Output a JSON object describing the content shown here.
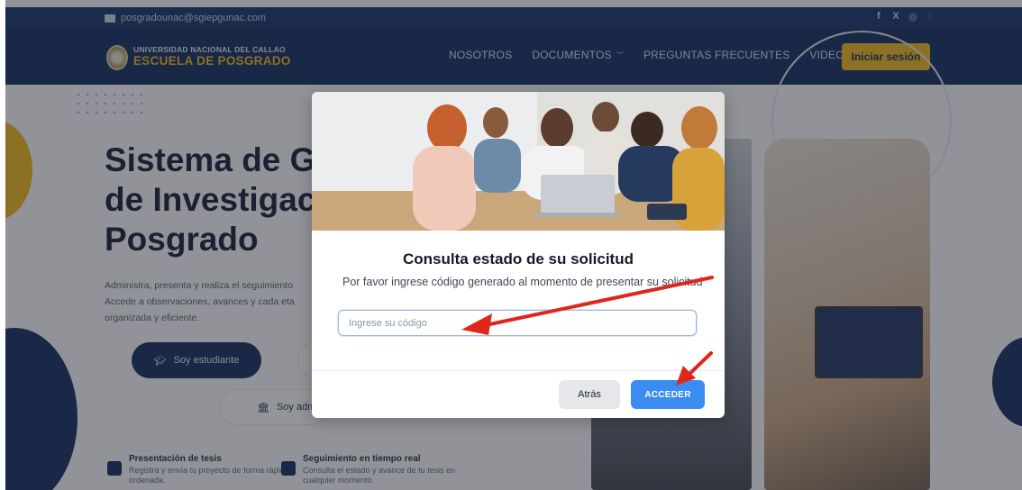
{
  "topbar": {
    "email": "posgradounac@sgiepgunac.com",
    "social_icons": [
      "facebook-icon",
      "x-icon",
      "instagram-icon",
      "whatsapp-icon"
    ]
  },
  "header": {
    "logo_top": "UNIVERSIDAD NACIONAL DEL CALLAO",
    "logo_bottom": "ESCUELA DE POSGRADO",
    "nav": [
      {
        "label": "NOSOTROS"
      },
      {
        "label": "DOCUMENTOS"
      },
      {
        "label": "PREGUNTAS FRECUENTES"
      },
      {
        "label": "VIDEOS"
      }
    ],
    "login_label": "Iniciar sesión"
  },
  "hero": {
    "title_line1": "Sistema de G",
    "title_line2": "de Investigac",
    "title_line3": "Posgrado",
    "desc_line1": "Administra, presenta y realiza el seguimiento",
    "desc_line2": "Accede a observaciones, avances y cada eta",
    "desc_line3": "organizada y eficiente.",
    "student_button": "Soy estudiante",
    "admin_button": "Soy adm",
    "features": [
      {
        "title": "Presentación de tesis",
        "line1": "Registra y envía tu proyecto de forma rápida y",
        "line2": "ordenada."
      },
      {
        "title": "Seguimiento en tiempo real",
        "line1": "Consulta el estado y avance de tu tesis en",
        "line2": "cualquier momento."
      }
    ]
  },
  "modal": {
    "title": "Consulta estado de su solicitud",
    "subtitle": "Por favor ingrese código generado al momento de presentar su solicitud",
    "input_placeholder": "Ingrese su código",
    "input_value": "",
    "back_label": "Atrás",
    "access_label": "ACCEDER"
  },
  "colors": {
    "navy": "#0b2559",
    "gold": "#f0b412",
    "primary_button": "#3b8cf0",
    "arrow": "#e0261b"
  }
}
